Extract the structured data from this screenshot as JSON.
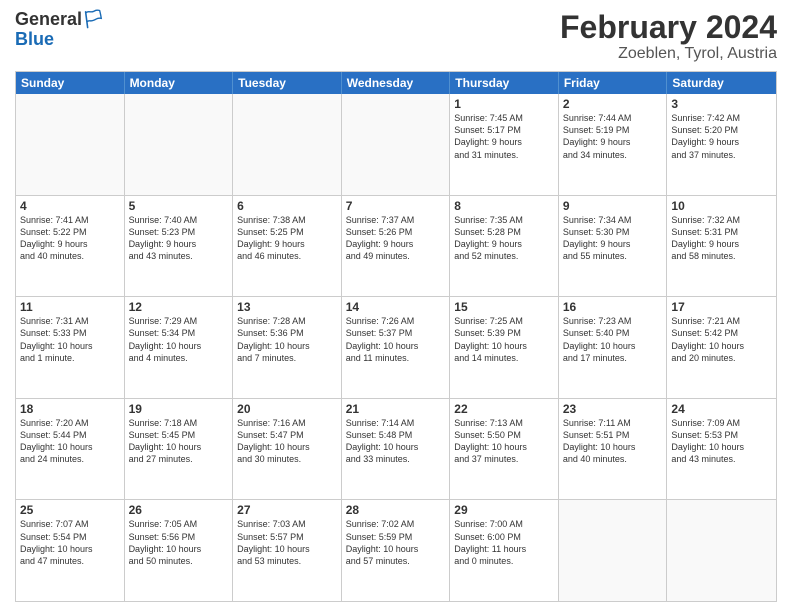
{
  "header": {
    "logo": {
      "line1": "General",
      "line2": "Blue"
    },
    "month": "February 2024",
    "location": "Zoeblen, Tyrol, Austria"
  },
  "calendar": {
    "weekdays": [
      "Sunday",
      "Monday",
      "Tuesday",
      "Wednesday",
      "Thursday",
      "Friday",
      "Saturday"
    ],
    "rows": [
      [
        {
          "day": "",
          "info": ""
        },
        {
          "day": "",
          "info": ""
        },
        {
          "day": "",
          "info": ""
        },
        {
          "day": "",
          "info": ""
        },
        {
          "day": "1",
          "info": "Sunrise: 7:45 AM\nSunset: 5:17 PM\nDaylight: 9 hours\nand 31 minutes."
        },
        {
          "day": "2",
          "info": "Sunrise: 7:44 AM\nSunset: 5:19 PM\nDaylight: 9 hours\nand 34 minutes."
        },
        {
          "day": "3",
          "info": "Sunrise: 7:42 AM\nSunset: 5:20 PM\nDaylight: 9 hours\nand 37 minutes."
        }
      ],
      [
        {
          "day": "4",
          "info": "Sunrise: 7:41 AM\nSunset: 5:22 PM\nDaylight: 9 hours\nand 40 minutes."
        },
        {
          "day": "5",
          "info": "Sunrise: 7:40 AM\nSunset: 5:23 PM\nDaylight: 9 hours\nand 43 minutes."
        },
        {
          "day": "6",
          "info": "Sunrise: 7:38 AM\nSunset: 5:25 PM\nDaylight: 9 hours\nand 46 minutes."
        },
        {
          "day": "7",
          "info": "Sunrise: 7:37 AM\nSunset: 5:26 PM\nDaylight: 9 hours\nand 49 minutes."
        },
        {
          "day": "8",
          "info": "Sunrise: 7:35 AM\nSunset: 5:28 PM\nDaylight: 9 hours\nand 52 minutes."
        },
        {
          "day": "9",
          "info": "Sunrise: 7:34 AM\nSunset: 5:30 PM\nDaylight: 9 hours\nand 55 minutes."
        },
        {
          "day": "10",
          "info": "Sunrise: 7:32 AM\nSunset: 5:31 PM\nDaylight: 9 hours\nand 58 minutes."
        }
      ],
      [
        {
          "day": "11",
          "info": "Sunrise: 7:31 AM\nSunset: 5:33 PM\nDaylight: 10 hours\nand 1 minute."
        },
        {
          "day": "12",
          "info": "Sunrise: 7:29 AM\nSunset: 5:34 PM\nDaylight: 10 hours\nand 4 minutes."
        },
        {
          "day": "13",
          "info": "Sunrise: 7:28 AM\nSunset: 5:36 PM\nDaylight: 10 hours\nand 7 minutes."
        },
        {
          "day": "14",
          "info": "Sunrise: 7:26 AM\nSunset: 5:37 PM\nDaylight: 10 hours\nand 11 minutes."
        },
        {
          "day": "15",
          "info": "Sunrise: 7:25 AM\nSunset: 5:39 PM\nDaylight: 10 hours\nand 14 minutes."
        },
        {
          "day": "16",
          "info": "Sunrise: 7:23 AM\nSunset: 5:40 PM\nDaylight: 10 hours\nand 17 minutes."
        },
        {
          "day": "17",
          "info": "Sunrise: 7:21 AM\nSunset: 5:42 PM\nDaylight: 10 hours\nand 20 minutes."
        }
      ],
      [
        {
          "day": "18",
          "info": "Sunrise: 7:20 AM\nSunset: 5:44 PM\nDaylight: 10 hours\nand 24 minutes."
        },
        {
          "day": "19",
          "info": "Sunrise: 7:18 AM\nSunset: 5:45 PM\nDaylight: 10 hours\nand 27 minutes."
        },
        {
          "day": "20",
          "info": "Sunrise: 7:16 AM\nSunset: 5:47 PM\nDaylight: 10 hours\nand 30 minutes."
        },
        {
          "day": "21",
          "info": "Sunrise: 7:14 AM\nSunset: 5:48 PM\nDaylight: 10 hours\nand 33 minutes."
        },
        {
          "day": "22",
          "info": "Sunrise: 7:13 AM\nSunset: 5:50 PM\nDaylight: 10 hours\nand 37 minutes."
        },
        {
          "day": "23",
          "info": "Sunrise: 7:11 AM\nSunset: 5:51 PM\nDaylight: 10 hours\nand 40 minutes."
        },
        {
          "day": "24",
          "info": "Sunrise: 7:09 AM\nSunset: 5:53 PM\nDaylight: 10 hours\nand 43 minutes."
        }
      ],
      [
        {
          "day": "25",
          "info": "Sunrise: 7:07 AM\nSunset: 5:54 PM\nDaylight: 10 hours\nand 47 minutes."
        },
        {
          "day": "26",
          "info": "Sunrise: 7:05 AM\nSunset: 5:56 PM\nDaylight: 10 hours\nand 50 minutes."
        },
        {
          "day": "27",
          "info": "Sunrise: 7:03 AM\nSunset: 5:57 PM\nDaylight: 10 hours\nand 53 minutes."
        },
        {
          "day": "28",
          "info": "Sunrise: 7:02 AM\nSunset: 5:59 PM\nDaylight: 10 hours\nand 57 minutes."
        },
        {
          "day": "29",
          "info": "Sunrise: 7:00 AM\nSunset: 6:00 PM\nDaylight: 11 hours\nand 0 minutes."
        },
        {
          "day": "",
          "info": ""
        },
        {
          "day": "",
          "info": ""
        }
      ]
    ]
  }
}
